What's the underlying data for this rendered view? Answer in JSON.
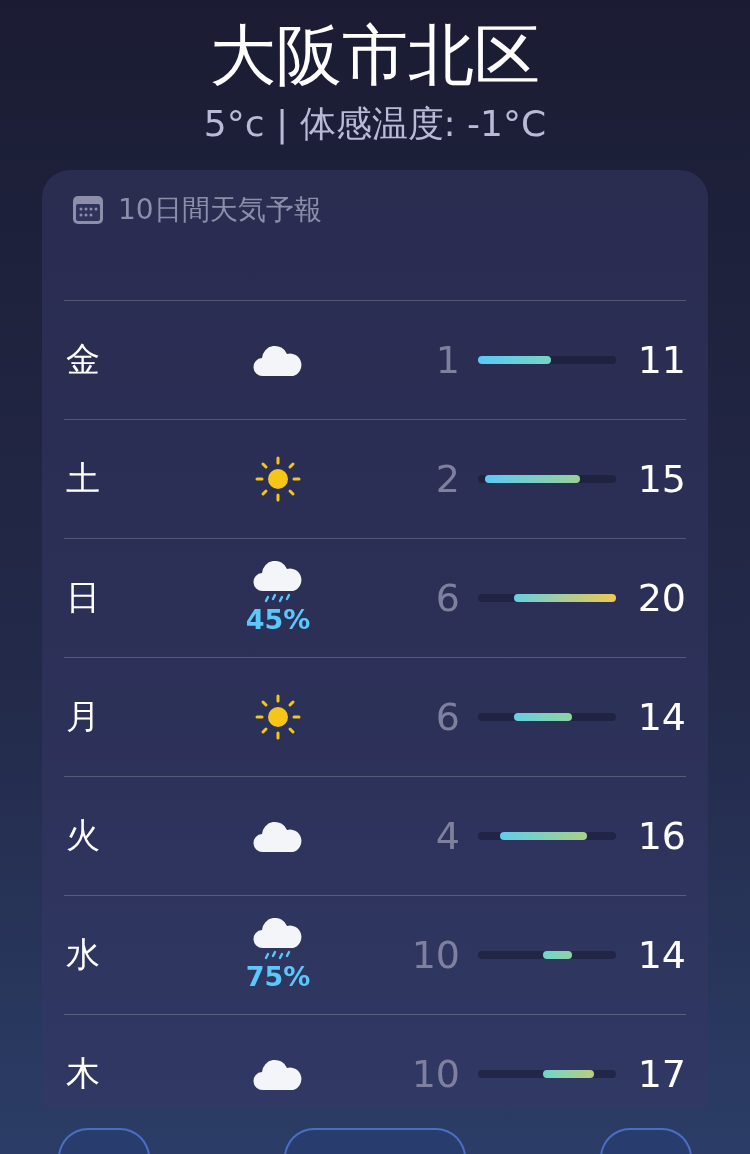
{
  "location": {
    "title": "大阪市北区",
    "subtitle": "5°c | 体感温度: -1°C"
  },
  "forecast": {
    "header": "10日間天気予報",
    "days": [
      {
        "day": "金",
        "kind": "cloud",
        "low": "1",
        "high": "11"
      },
      {
        "day": "土",
        "kind": "sun",
        "low": "2",
        "high": "15"
      },
      {
        "day": "日",
        "kind": "rain",
        "precip": "45%",
        "low": "6",
        "high": "20"
      },
      {
        "day": "月",
        "kind": "sun",
        "low": "6",
        "high": "14"
      },
      {
        "day": "火",
        "kind": "cloud",
        "low": "4",
        "high": "16"
      },
      {
        "day": "水",
        "kind": "rain",
        "precip": "75%",
        "low": "10",
        "high": "14"
      },
      {
        "day": "木",
        "kind": "cloud",
        "low": "10",
        "high": "17"
      }
    ]
  }
}
